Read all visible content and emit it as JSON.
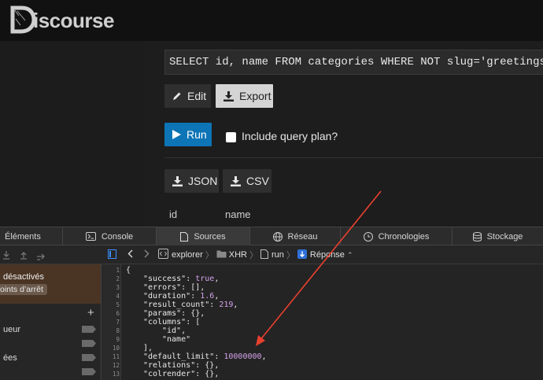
{
  "discourse": {
    "logo_text": "iscourse",
    "sql": "SELECT id, name  FROM categories WHERE NOT slug='greetings'",
    "edit_label": "Edit",
    "export_label": "Export",
    "run_label": "Run",
    "include_plan_label": "Include query plan?",
    "json_label": "JSON",
    "csv_label": "CSV",
    "col_id": "id",
    "col_name": "name"
  },
  "devtools": {
    "tabs": [
      "Éléments",
      "Console",
      "Sources",
      "Réseau",
      "Chronologies",
      "Stockage"
    ],
    "active_tab": "Sources",
    "breadcrumbs": [
      "explorer",
      "XHR",
      "run",
      "Réponse"
    ],
    "breakpoints_title": "désactivés",
    "breakpoints_chip": "oints d’arrêt",
    "left_rows": [
      "ueur",
      "ées"
    ],
    "code_lines": [
      {
        "n": "1",
        "text": "{"
      },
      {
        "n": "2",
        "key": "\"success\"",
        "val": "true",
        "tail": ","
      },
      {
        "n": "3",
        "key": "\"errors\"",
        "val": "[]",
        "tail": ","
      },
      {
        "n": "4",
        "key": "\"duration\"",
        "val": "1.6",
        "tail": ","
      },
      {
        "n": "5",
        "key": "\"result_count\"",
        "val": "219",
        "tail": ","
      },
      {
        "n": "6",
        "key": "\"params\"",
        "val": "{}",
        "tail": ","
      },
      {
        "n": "7",
        "key": "\"columns\"",
        "val": "[",
        "tail": ""
      },
      {
        "n": "8",
        "str": "\"id\"",
        "tail": ","
      },
      {
        "n": "9",
        "str": "\"name\"",
        "tail": ""
      },
      {
        "n": "10",
        "text": "],"
      },
      {
        "n": "11",
        "key": "\"default_limit\"",
        "val": "10000000",
        "tail": ","
      },
      {
        "n": "12",
        "key": "\"relations\"",
        "val": "{}",
        "tail": ","
      },
      {
        "n": "13",
        "key": "\"colrender\"",
        "val": "{}",
        "tail": ","
      }
    ]
  },
  "colors": {
    "run_blue": "#0d75b6",
    "arrow_red": "#e8402f",
    "json_number": "#d3a2ea"
  }
}
